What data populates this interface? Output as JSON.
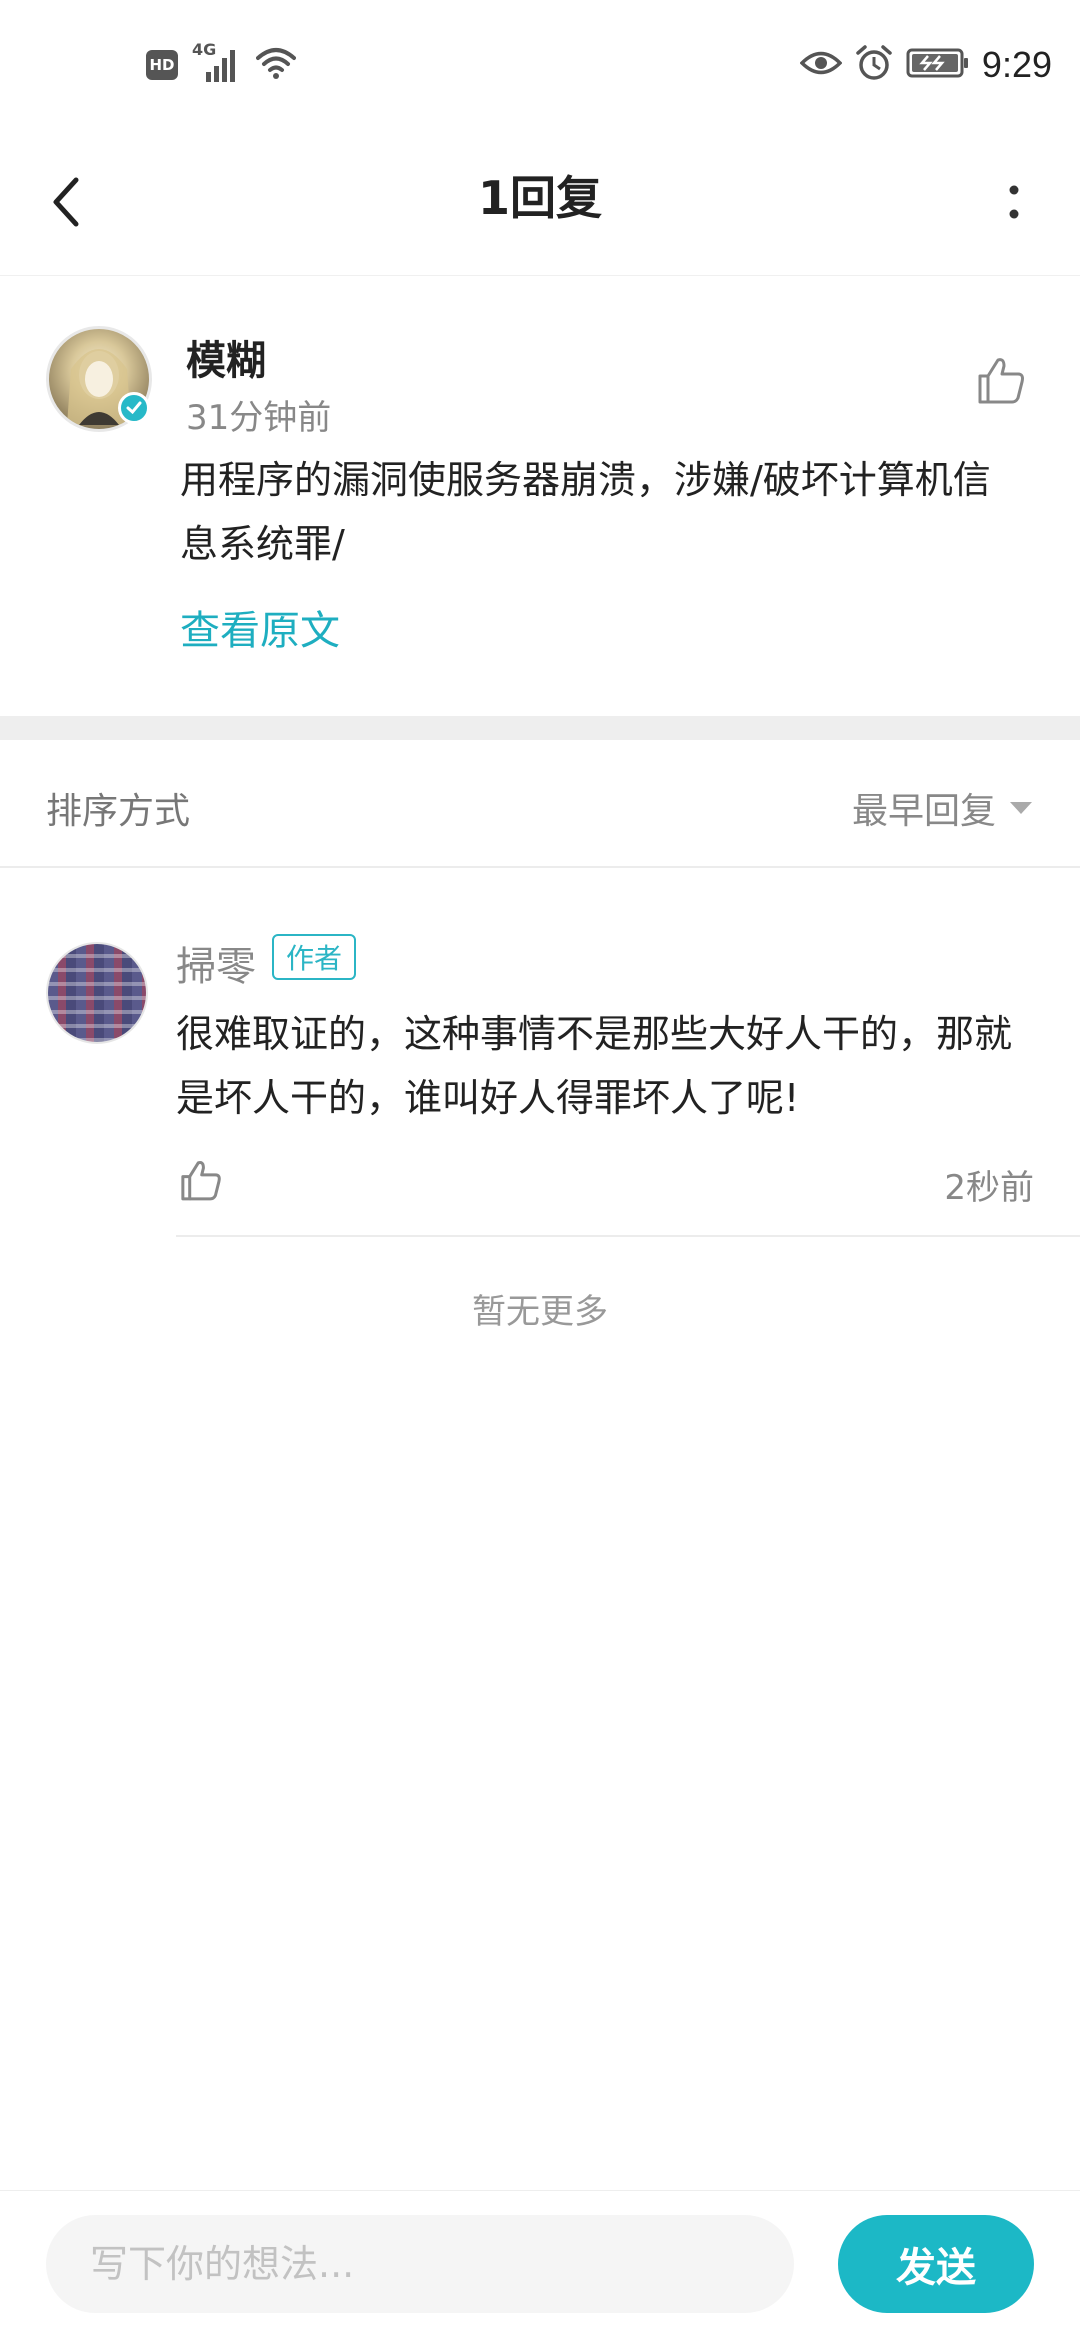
{
  "status_bar": {
    "hd": "HD",
    "network": "4G",
    "time": "9:29",
    "icons": [
      "hd-icon",
      "signal-icon",
      "wifi-icon",
      "eye-icon",
      "alarm-icon",
      "battery-icon"
    ]
  },
  "header": {
    "title": "1回复",
    "back_icon": "chevron-left-icon",
    "more_icon": "more-vertical-icon"
  },
  "original_comment": {
    "author": "模糊",
    "time": "31分钟前",
    "text": "用程序的漏洞使服务器崩溃，涉嫌/破坏计算机信息系统罪/",
    "view_original": "查看原文",
    "verified": true
  },
  "sort": {
    "label": "排序方式",
    "value": "最早回复"
  },
  "replies": [
    {
      "author": "掃零",
      "tag": "作者",
      "text": "很难取证的，这种事情不是那些大好人干的，那就是坏人干的，谁叫好人得罪坏人了呢!",
      "time": "2秒前"
    }
  ],
  "footer_note": "暂无更多",
  "input_bar": {
    "placeholder": "写下你的想法...",
    "send_label": "发送"
  },
  "colors": {
    "accent": "#1cb8c6",
    "link": "#1eaec0",
    "text": "#222222",
    "muted": "#888888"
  }
}
